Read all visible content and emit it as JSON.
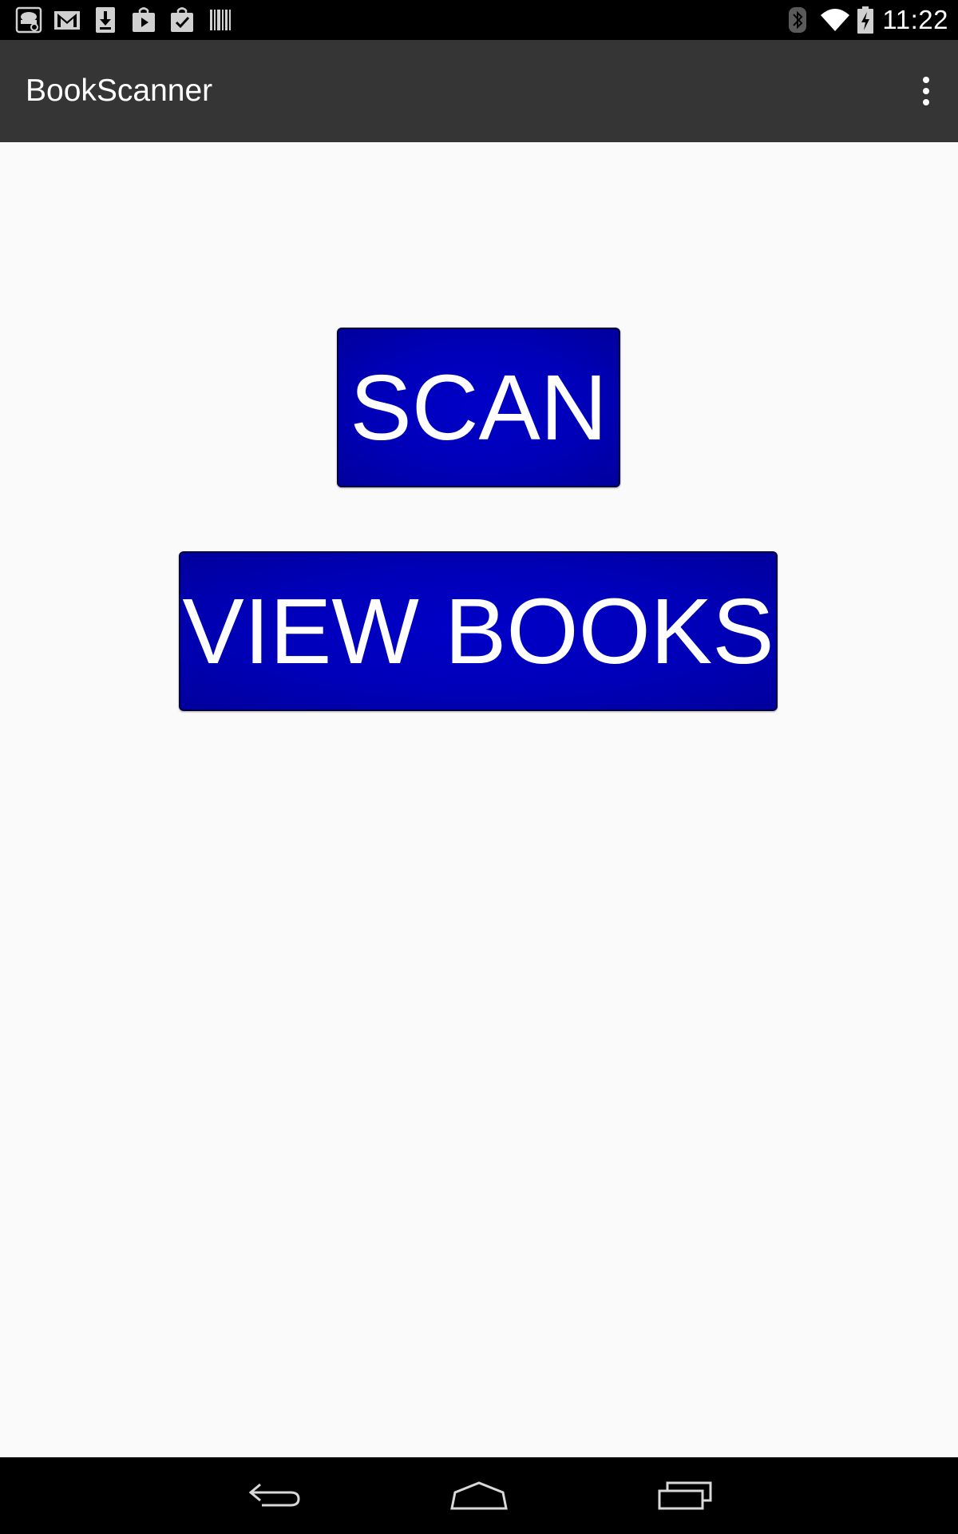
{
  "status_bar": {
    "time": "11:22",
    "notification_icons": [
      "launcher-icon",
      "gmail-icon",
      "download-icon",
      "play-store-icon",
      "store-update-icon",
      "barcode-icon"
    ],
    "system_icons": [
      "bluetooth-icon",
      "wifi-icon",
      "battery-charging-icon"
    ]
  },
  "action_bar": {
    "title": "BookScanner",
    "overflow_icon": "more-vert-icon"
  },
  "main": {
    "scan_label": "SCAN",
    "view_books_label": "VIEW BOOKS"
  },
  "nav_bar": {
    "icons": [
      "back-icon",
      "home-icon",
      "recents-icon"
    ]
  },
  "colors": {
    "status_bar_bg": "#000000",
    "action_bar_bg": "#353535",
    "content_bg": "#fafafa",
    "button_bg": "#0000c0",
    "button_text": "#ffffff",
    "nav_bar_bg": "#000000"
  }
}
